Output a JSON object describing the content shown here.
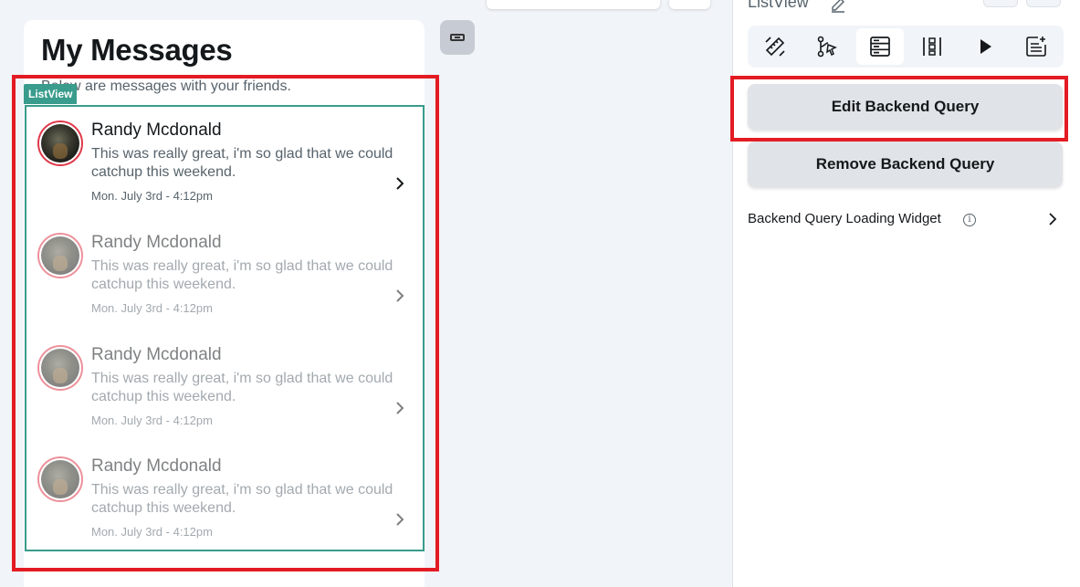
{
  "canvas": {
    "page_title": "My Messages",
    "page_subtitle": "Below are messages with your friends.",
    "listview_badge": "ListView",
    "messages": [
      {
        "name": "Randy Mcdonald",
        "text": "This was really great, i'm so glad that we could catchup this weekend.",
        "date": "Mon. July 3rd - 4:12pm"
      },
      {
        "name": "Randy Mcdonald",
        "text": "This was really great, i'm so glad that we could catchup this weekend.",
        "date": "Mon. July 3rd - 4:12pm"
      },
      {
        "name": "Randy Mcdonald",
        "text": "This was really great, i'm so glad that we could catchup this weekend.",
        "date": "Mon. July 3rd - 4:12pm"
      },
      {
        "name": "Randy Mcdonald",
        "text": "This was really great, i'm so glad that we could catchup this weekend.",
        "date": "Mon. July 3rd - 4:12pm"
      }
    ]
  },
  "panel": {
    "widget_name": "ListView",
    "tabs": [
      {
        "icon": "properties-icon"
      },
      {
        "icon": "actions-icon"
      },
      {
        "icon": "backend-query-icon",
        "active": true
      },
      {
        "icon": "layout-icon"
      },
      {
        "icon": "animation-icon"
      },
      {
        "icon": "documentation-icon"
      }
    ],
    "edit_query_label": "Edit Backend Query",
    "remove_query_label": "Remove Backend Query",
    "loading_widget_label": "Backend Query Loading Widget",
    "info_glyph": "i"
  },
  "colors": {
    "listview_border": "#399c8c",
    "highlight": "#e31b23",
    "avatar_ring": "#e0394a"
  }
}
